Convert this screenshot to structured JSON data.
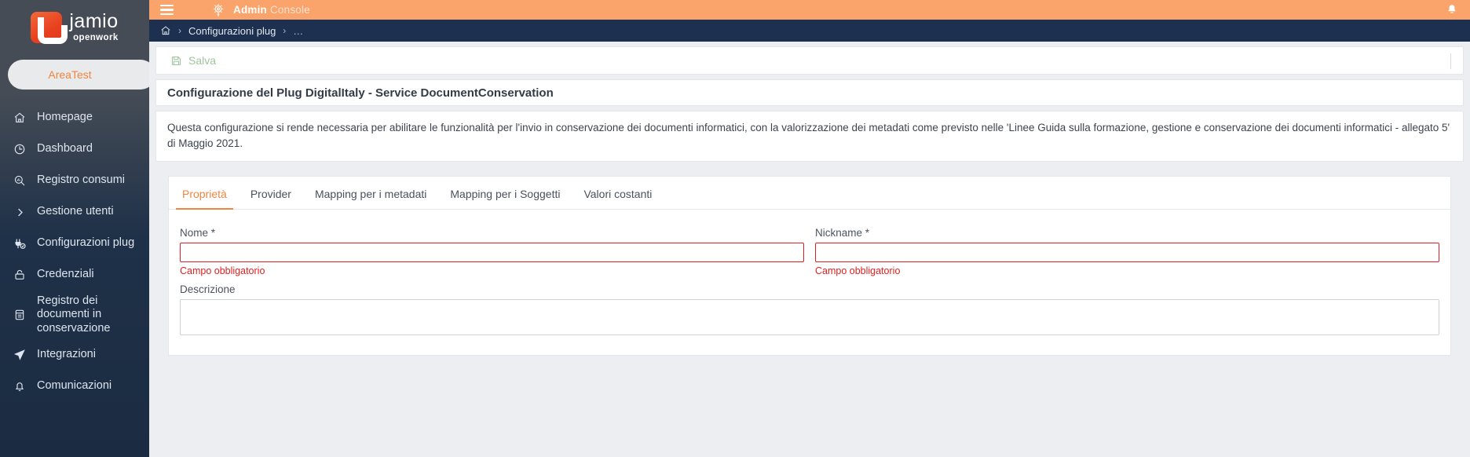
{
  "brand": {
    "name": "jamio",
    "subtitle": "openwork",
    "logo_icon": "jamio-j-logo",
    "area_label": "AreaTest"
  },
  "sidebar": {
    "items": [
      {
        "label": "Homepage",
        "icon": "home-icon"
      },
      {
        "label": "Dashboard",
        "icon": "clock-icon"
      },
      {
        "label": "Registro consumi",
        "icon": "chart-search-icon"
      },
      {
        "label": "Gestione utenti",
        "icon": "chevron-right-icon"
      },
      {
        "label": "Configurazioni plug",
        "icon": "plug-check-icon"
      },
      {
        "label": "Credenziali",
        "icon": "lock-icon"
      },
      {
        "label": "Registro dei documenti in conservazione",
        "icon": "book-icon"
      },
      {
        "label": "Integrazioni",
        "icon": "send-icon"
      },
      {
        "label": "Comunicazioni",
        "icon": "bell-outline-icon"
      }
    ]
  },
  "topbar": {
    "menu_icon": "hamburger-icon",
    "logo_icon": "lightbulb-gear-icon",
    "title_strong": "Admin",
    "title_rest": "Console",
    "notifications_icon": "bell-icon"
  },
  "breadcrumb": {
    "home_icon": "home-icon",
    "separator": "›",
    "items": [
      {
        "label": "Configurazioni plug"
      },
      {
        "label": "…"
      }
    ]
  },
  "toolbar": {
    "save_label": "Salva",
    "save_icon": "floppy-disk-icon"
  },
  "page": {
    "title": "Configurazione del Plug DigitalItaly - Service DocumentConservation",
    "description": "Questa configurazione si rende necessaria per abilitare le funzionalità per l'invio in conservazione dei documenti informatici, con la valorizzazione dei metadati come previsto nelle 'Linee Guida sulla formazione, gestione e conservazione dei documenti informatici - allegato 5' di Maggio 2021."
  },
  "tabs": [
    {
      "label": "Proprietà",
      "active": true
    },
    {
      "label": "Provider",
      "active": false
    },
    {
      "label": "Mapping per i metadati",
      "active": false
    },
    {
      "label": "Mapping per i Soggetti",
      "active": false
    },
    {
      "label": "Valori costanti",
      "active": false
    }
  ],
  "form": {
    "nome": {
      "label": "Nome *",
      "value": "",
      "placeholder": "",
      "error": "Campo obbligatorio"
    },
    "nickname": {
      "label": "Nickname *",
      "value": "",
      "placeholder": "",
      "error": "Campo obbligatorio"
    },
    "descrizione": {
      "label": "Descrizione",
      "value": "",
      "placeholder": ""
    }
  },
  "colors": {
    "accent": "#f0853f",
    "topbar": "#faa36a",
    "sidebar_top": "#454c56",
    "sidebar_bottom": "#1b2c42",
    "breadcrumb_bg": "#1d3050",
    "error": "#e02020",
    "save_disabled": "#9fc49f"
  }
}
